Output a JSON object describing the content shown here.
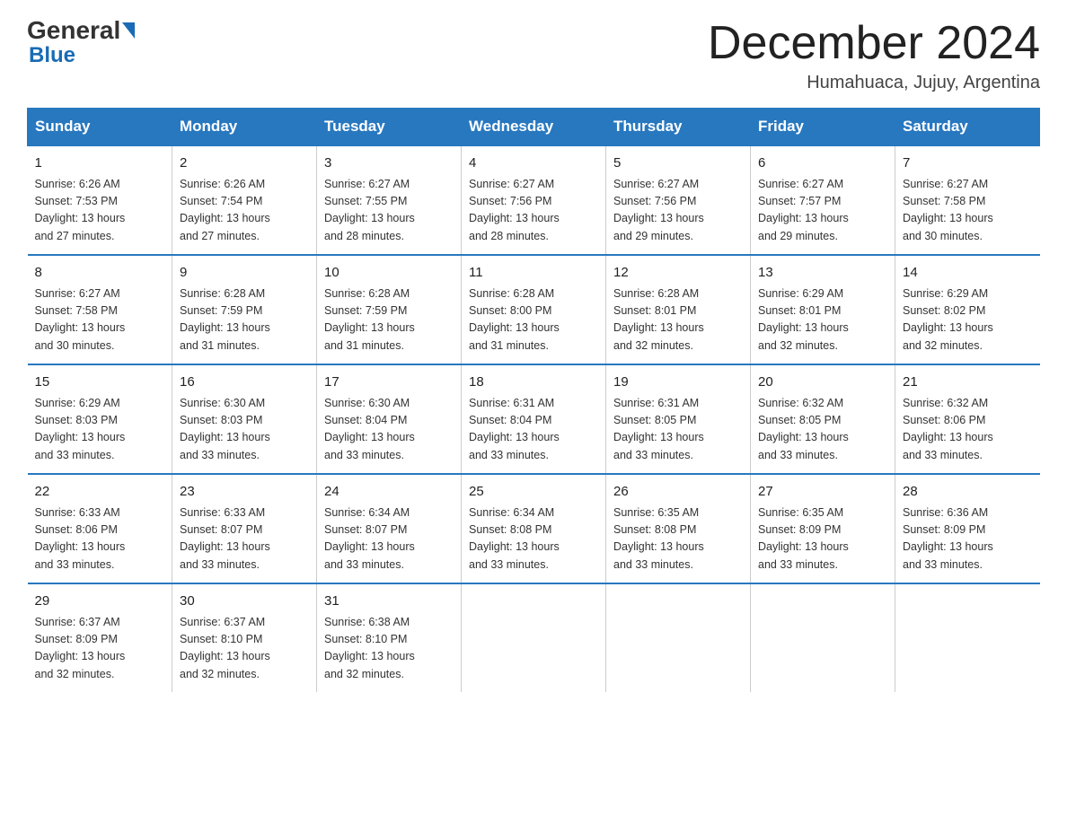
{
  "logo": {
    "general": "General",
    "blue": "Blue"
  },
  "title": "December 2024",
  "subtitle": "Humahuaca, Jujuy, Argentina",
  "header": {
    "accent_color": "#2878c0"
  },
  "weekdays": [
    "Sunday",
    "Monday",
    "Tuesday",
    "Wednesday",
    "Thursday",
    "Friday",
    "Saturday"
  ],
  "weeks": [
    [
      {
        "day": "1",
        "sunrise": "6:26 AM",
        "sunset": "7:53 PM",
        "daylight": "13 hours and 27 minutes."
      },
      {
        "day": "2",
        "sunrise": "6:26 AM",
        "sunset": "7:54 PM",
        "daylight": "13 hours and 27 minutes."
      },
      {
        "day": "3",
        "sunrise": "6:27 AM",
        "sunset": "7:55 PM",
        "daylight": "13 hours and 28 minutes."
      },
      {
        "day": "4",
        "sunrise": "6:27 AM",
        "sunset": "7:56 PM",
        "daylight": "13 hours and 28 minutes."
      },
      {
        "day": "5",
        "sunrise": "6:27 AM",
        "sunset": "7:56 PM",
        "daylight": "13 hours and 29 minutes."
      },
      {
        "day": "6",
        "sunrise": "6:27 AM",
        "sunset": "7:57 PM",
        "daylight": "13 hours and 29 minutes."
      },
      {
        "day": "7",
        "sunrise": "6:27 AM",
        "sunset": "7:58 PM",
        "daylight": "13 hours and 30 minutes."
      }
    ],
    [
      {
        "day": "8",
        "sunrise": "6:27 AM",
        "sunset": "7:58 PM",
        "daylight": "13 hours and 30 minutes."
      },
      {
        "day": "9",
        "sunrise": "6:28 AM",
        "sunset": "7:59 PM",
        "daylight": "13 hours and 31 minutes."
      },
      {
        "day": "10",
        "sunrise": "6:28 AM",
        "sunset": "7:59 PM",
        "daylight": "13 hours and 31 minutes."
      },
      {
        "day": "11",
        "sunrise": "6:28 AM",
        "sunset": "8:00 PM",
        "daylight": "13 hours and 31 minutes."
      },
      {
        "day": "12",
        "sunrise": "6:28 AM",
        "sunset": "8:01 PM",
        "daylight": "13 hours and 32 minutes."
      },
      {
        "day": "13",
        "sunrise": "6:29 AM",
        "sunset": "8:01 PM",
        "daylight": "13 hours and 32 minutes."
      },
      {
        "day": "14",
        "sunrise": "6:29 AM",
        "sunset": "8:02 PM",
        "daylight": "13 hours and 32 minutes."
      }
    ],
    [
      {
        "day": "15",
        "sunrise": "6:29 AM",
        "sunset": "8:03 PM",
        "daylight": "13 hours and 33 minutes."
      },
      {
        "day": "16",
        "sunrise": "6:30 AM",
        "sunset": "8:03 PM",
        "daylight": "13 hours and 33 minutes."
      },
      {
        "day": "17",
        "sunrise": "6:30 AM",
        "sunset": "8:04 PM",
        "daylight": "13 hours and 33 minutes."
      },
      {
        "day": "18",
        "sunrise": "6:31 AM",
        "sunset": "8:04 PM",
        "daylight": "13 hours and 33 minutes."
      },
      {
        "day": "19",
        "sunrise": "6:31 AM",
        "sunset": "8:05 PM",
        "daylight": "13 hours and 33 minutes."
      },
      {
        "day": "20",
        "sunrise": "6:32 AM",
        "sunset": "8:05 PM",
        "daylight": "13 hours and 33 minutes."
      },
      {
        "day": "21",
        "sunrise": "6:32 AM",
        "sunset": "8:06 PM",
        "daylight": "13 hours and 33 minutes."
      }
    ],
    [
      {
        "day": "22",
        "sunrise": "6:33 AM",
        "sunset": "8:06 PM",
        "daylight": "13 hours and 33 minutes."
      },
      {
        "day": "23",
        "sunrise": "6:33 AM",
        "sunset": "8:07 PM",
        "daylight": "13 hours and 33 minutes."
      },
      {
        "day": "24",
        "sunrise": "6:34 AM",
        "sunset": "8:07 PM",
        "daylight": "13 hours and 33 minutes."
      },
      {
        "day": "25",
        "sunrise": "6:34 AM",
        "sunset": "8:08 PM",
        "daylight": "13 hours and 33 minutes."
      },
      {
        "day": "26",
        "sunrise": "6:35 AM",
        "sunset": "8:08 PM",
        "daylight": "13 hours and 33 minutes."
      },
      {
        "day": "27",
        "sunrise": "6:35 AM",
        "sunset": "8:09 PM",
        "daylight": "13 hours and 33 minutes."
      },
      {
        "day": "28",
        "sunrise": "6:36 AM",
        "sunset": "8:09 PM",
        "daylight": "13 hours and 33 minutes."
      }
    ],
    [
      {
        "day": "29",
        "sunrise": "6:37 AM",
        "sunset": "8:09 PM",
        "daylight": "13 hours and 32 minutes."
      },
      {
        "day": "30",
        "sunrise": "6:37 AM",
        "sunset": "8:10 PM",
        "daylight": "13 hours and 32 minutes."
      },
      {
        "day": "31",
        "sunrise": "6:38 AM",
        "sunset": "8:10 PM",
        "daylight": "13 hours and 32 minutes."
      },
      null,
      null,
      null,
      null
    ]
  ],
  "labels": {
    "sunrise": "Sunrise:",
    "sunset": "Sunset:",
    "daylight": "Daylight:"
  }
}
